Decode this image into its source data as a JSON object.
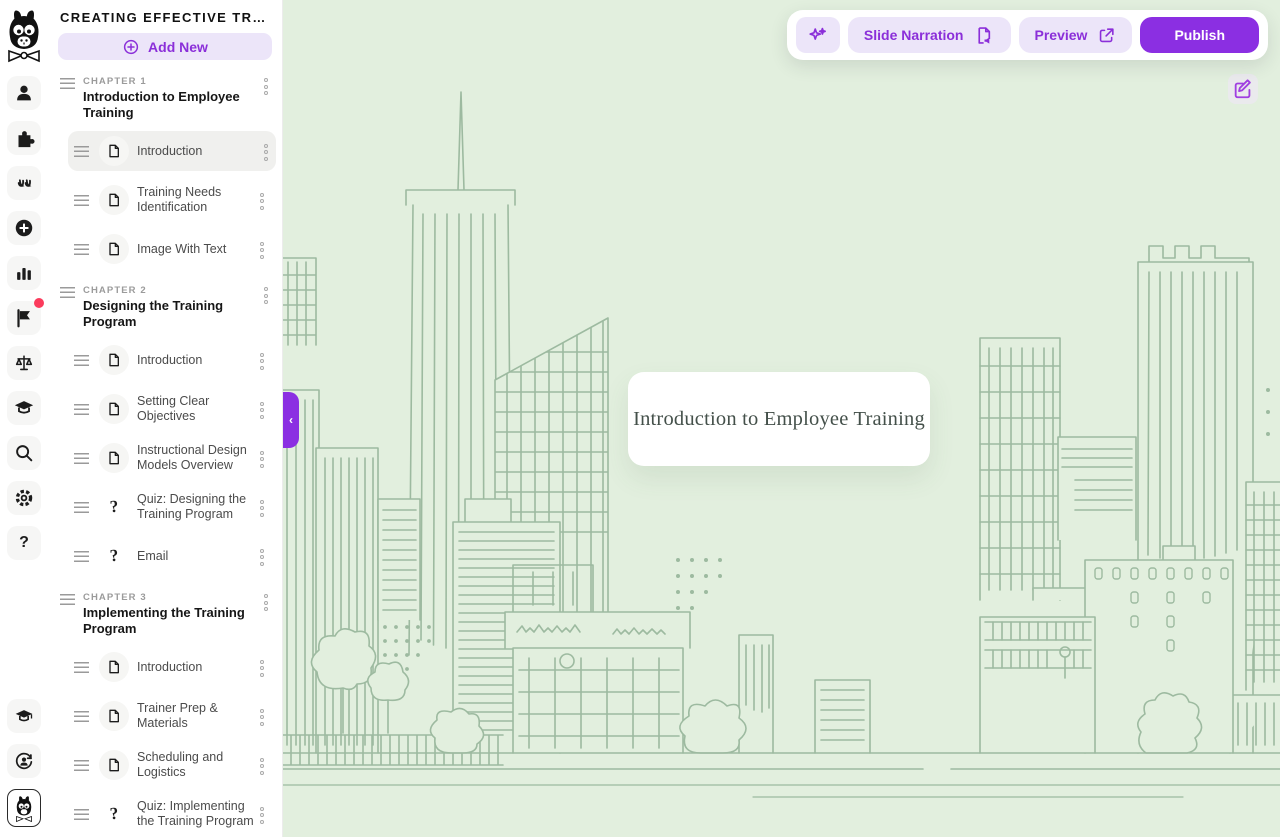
{
  "colors": {
    "accent": "#8b2fe2",
    "accent_light": "#ece5f9",
    "accent_text": "#8b2fd9",
    "canvas_bg": "#e2efde",
    "sketch_line": "#9dbaa0",
    "badge_red": "#fb3b5c"
  },
  "rail": {
    "items": [
      {
        "icon": "user-icon"
      },
      {
        "icon": "puzzle-icon"
      },
      {
        "icon": "hooves-icon"
      },
      {
        "icon": "add-circle-icon"
      },
      {
        "icon": "bar-chart-icon"
      },
      {
        "icon": "flag-icon",
        "has_badge": true
      },
      {
        "icon": "scales-icon"
      },
      {
        "icon": "graduation-cap-icon"
      },
      {
        "icon": "search-icon"
      },
      {
        "icon": "gear-icon"
      },
      {
        "icon": "help-icon"
      }
    ],
    "bottom_items": [
      {
        "icon": "academy-cap-icon"
      },
      {
        "icon": "account-switch-icon"
      },
      {
        "icon": "llama-avatar"
      }
    ]
  },
  "sidebar": {
    "title": "CREATING EFFECTIVE TRAI…",
    "add_new_label": "Add New",
    "chapters": [
      {
        "label": "CHAPTER 1",
        "title": "Introduction to Employee Training",
        "items": [
          {
            "label": "Introduction",
            "type": "page",
            "selected": true
          },
          {
            "label": "Training Needs Identification",
            "type": "page"
          },
          {
            "label": "Image With Text",
            "type": "page"
          }
        ]
      },
      {
        "label": "CHAPTER 2",
        "title": "Designing the Training Program",
        "items": [
          {
            "label": "Introduction",
            "type": "page"
          },
          {
            "label": "Setting Clear Objectives",
            "type": "page"
          },
          {
            "label": "Instructional Design Models Overview",
            "type": "page"
          },
          {
            "label": "Quiz: Designing the Training Program",
            "type": "quiz"
          },
          {
            "label": "Email",
            "type": "quiz"
          }
        ]
      },
      {
        "label": "CHAPTER 3",
        "title": "Implementing the Training Program",
        "items": [
          {
            "label": "Introduction",
            "type": "page"
          },
          {
            "label": "Trainer Prep & Materials",
            "type": "page"
          },
          {
            "label": "Scheduling and Logistics",
            "type": "page"
          },
          {
            "label": "Quiz: Implementing the Training Program",
            "type": "quiz"
          }
        ]
      }
    ]
  },
  "actions": {
    "slide_narration_label": "Slide Narration",
    "preview_label": "Preview",
    "publish_label": "Publish"
  },
  "canvas": {
    "slide_title": "Introduction to Employee Training"
  },
  "icons": {
    "quiz_glyph": "?",
    "help_glyph": "?",
    "collapse_glyph": "‹"
  }
}
